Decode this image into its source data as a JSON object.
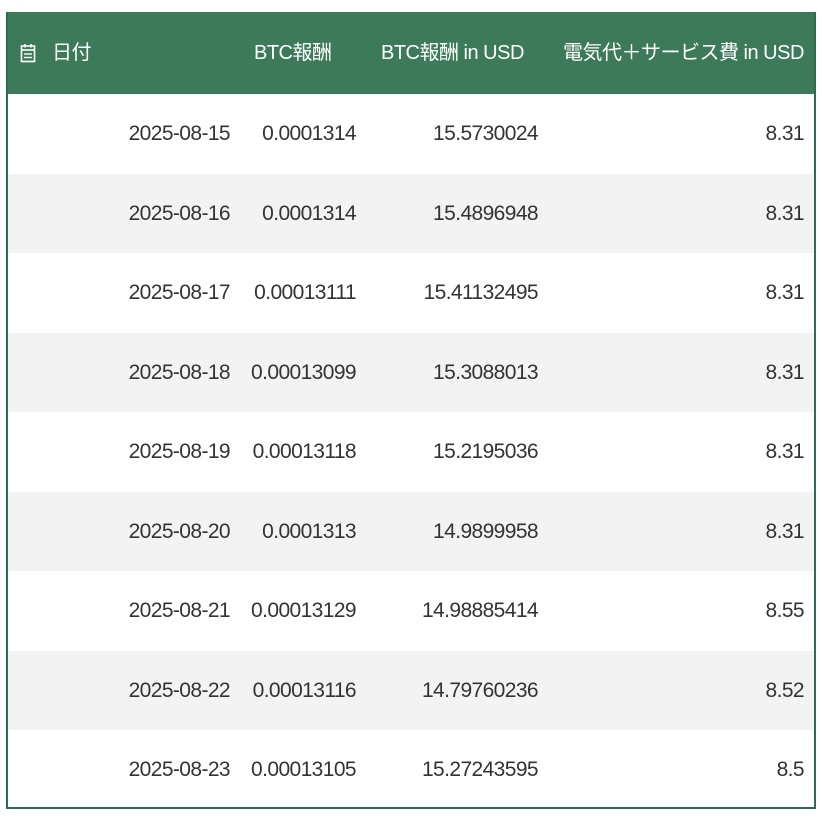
{
  "table": {
    "columns": [
      {
        "key": "date",
        "label": "日付",
        "icon": "calendar-icon"
      },
      {
        "key": "btc",
        "label": "BTC報酬"
      },
      {
        "key": "btc_usd",
        "label": "BTC報酬 in USD"
      },
      {
        "key": "fee_usd",
        "label": "電気代＋サービス費 in USD"
      }
    ],
    "rows": [
      {
        "date": "2025-08-15",
        "btc": "0.0001314",
        "btc_usd": "15.5730024",
        "fee_usd": "8.31"
      },
      {
        "date": "2025-08-16",
        "btc": "0.0001314",
        "btc_usd": "15.4896948",
        "fee_usd": "8.31"
      },
      {
        "date": "2025-08-17",
        "btc": "0.00013111",
        "btc_usd": "15.41132495",
        "fee_usd": "8.31"
      },
      {
        "date": "2025-08-18",
        "btc": "0.00013099",
        "btc_usd": "15.3088013",
        "fee_usd": "8.31"
      },
      {
        "date": "2025-08-19",
        "btc": "0.00013118",
        "btc_usd": "15.2195036",
        "fee_usd": "8.31"
      },
      {
        "date": "2025-08-20",
        "btc": "0.0001313",
        "btc_usd": "14.9899958",
        "fee_usd": "8.31"
      },
      {
        "date": "2025-08-21",
        "btc": "0.00013129",
        "btc_usd": "14.98885414",
        "fee_usd": "8.55"
      },
      {
        "date": "2025-08-22",
        "btc": "0.00013116",
        "btc_usd": "14.79760236",
        "fee_usd": "8.52"
      },
      {
        "date": "2025-08-23",
        "btc": "0.00013105",
        "btc_usd": "15.27243595",
        "fee_usd": "8.5"
      }
    ]
  },
  "colors": {
    "header_bg": "#3d7a5a",
    "border": "#2f6b4e",
    "stripe": "#f3f3f3",
    "text": "#333333"
  }
}
